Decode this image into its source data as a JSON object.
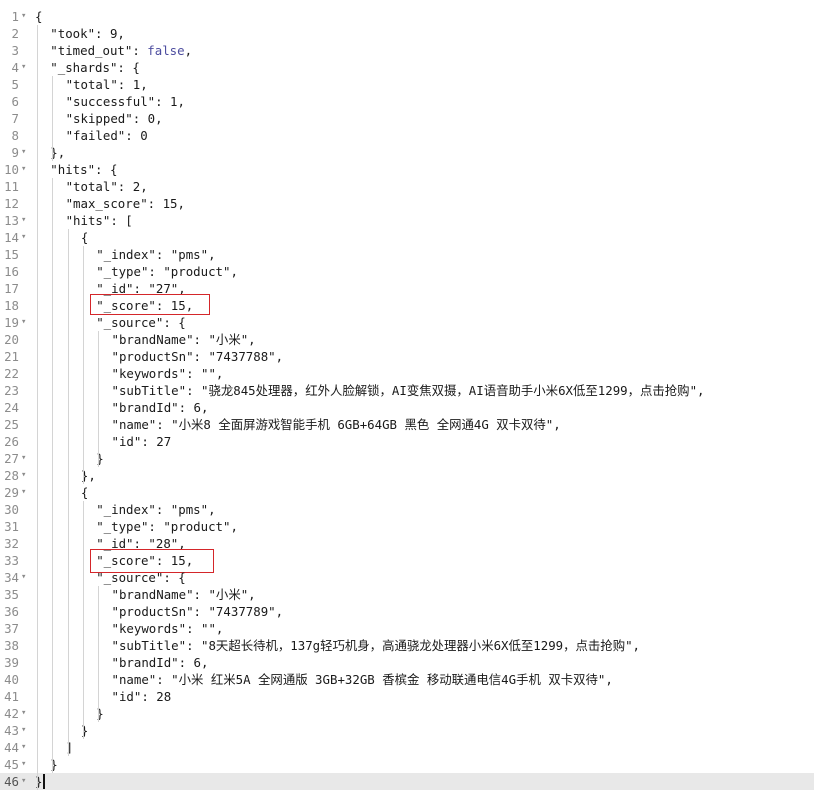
{
  "lines": [
    {
      "n": "1",
      "fold": true,
      "indent": 0,
      "text": "{"
    },
    {
      "n": "2",
      "fold": false,
      "indent": 1,
      "text": "\"took\": 9,"
    },
    {
      "n": "3",
      "fold": false,
      "indent": 1,
      "text": "\"timed_out\": false,"
    },
    {
      "n": "4",
      "fold": true,
      "indent": 1,
      "text": "\"_shards\": {"
    },
    {
      "n": "5",
      "fold": false,
      "indent": 2,
      "text": "\"total\": 1,"
    },
    {
      "n": "6",
      "fold": false,
      "indent": 2,
      "text": "\"successful\": 1,"
    },
    {
      "n": "7",
      "fold": false,
      "indent": 2,
      "text": "\"skipped\": 0,"
    },
    {
      "n": "8",
      "fold": false,
      "indent": 2,
      "text": "\"failed\": 0"
    },
    {
      "n": "9",
      "fold": true,
      "indent": 1,
      "text": "},"
    },
    {
      "n": "10",
      "fold": true,
      "indent": 1,
      "text": "\"hits\": {"
    },
    {
      "n": "11",
      "fold": false,
      "indent": 2,
      "text": "\"total\": 2,"
    },
    {
      "n": "12",
      "fold": false,
      "indent": 2,
      "text": "\"max_score\": 15,"
    },
    {
      "n": "13",
      "fold": true,
      "indent": 2,
      "text": "\"hits\": ["
    },
    {
      "n": "14",
      "fold": true,
      "indent": 3,
      "text": "{"
    },
    {
      "n": "15",
      "fold": false,
      "indent": 4,
      "text": "\"_index\": \"pms\","
    },
    {
      "n": "16",
      "fold": false,
      "indent": 4,
      "text": "\"_type\": \"product\","
    },
    {
      "n": "17",
      "fold": false,
      "indent": 4,
      "text": "\"_id\": \"27\","
    },
    {
      "n": "18",
      "fold": false,
      "indent": 4,
      "text": "\"_score\": 15,"
    },
    {
      "n": "19",
      "fold": true,
      "indent": 4,
      "text": "\"_source\": {"
    },
    {
      "n": "20",
      "fold": false,
      "indent": 5,
      "text": "\"brandName\": \"小米\","
    },
    {
      "n": "21",
      "fold": false,
      "indent": 5,
      "text": "\"productSn\": \"7437788\","
    },
    {
      "n": "22",
      "fold": false,
      "indent": 5,
      "text": "\"keywords\": \"\","
    },
    {
      "n": "23",
      "fold": false,
      "indent": 5,
      "text": "\"subTitle\": \"骁龙845处理器，红外人脸解锁，AI变焦双摄，AI语音助手小米6X低至1299，点击抢购\","
    },
    {
      "n": "24",
      "fold": false,
      "indent": 5,
      "text": "\"brandId\": 6,"
    },
    {
      "n": "25",
      "fold": false,
      "indent": 5,
      "text": "\"name\": \"小米8 全面屏游戏智能手机 6GB+64GB 黑色 全网通4G 双卡双待\","
    },
    {
      "n": "26",
      "fold": false,
      "indent": 5,
      "text": "\"id\": 27"
    },
    {
      "n": "27",
      "fold": true,
      "indent": 4,
      "text": "}"
    },
    {
      "n": "28",
      "fold": true,
      "indent": 3,
      "text": "},"
    },
    {
      "n": "29",
      "fold": true,
      "indent": 3,
      "text": "{"
    },
    {
      "n": "30",
      "fold": false,
      "indent": 4,
      "text": "\"_index\": \"pms\","
    },
    {
      "n": "31",
      "fold": false,
      "indent": 4,
      "text": "\"_type\": \"product\","
    },
    {
      "n": "32",
      "fold": false,
      "indent": 4,
      "text": "\"_id\": \"28\","
    },
    {
      "n": "33",
      "fold": false,
      "indent": 4,
      "text": "\"_score\": 15,"
    },
    {
      "n": "34",
      "fold": true,
      "indent": 4,
      "text": "\"_source\": {"
    },
    {
      "n": "35",
      "fold": false,
      "indent": 5,
      "text": "\"brandName\": \"小米\","
    },
    {
      "n": "36",
      "fold": false,
      "indent": 5,
      "text": "\"productSn\": \"7437789\","
    },
    {
      "n": "37",
      "fold": false,
      "indent": 5,
      "text": "\"keywords\": \"\","
    },
    {
      "n": "38",
      "fold": false,
      "indent": 5,
      "text": "\"subTitle\": \"8天超长待机，137g轻巧机身，高通骁龙处理器小米6X低至1299，点击抢购\","
    },
    {
      "n": "39",
      "fold": false,
      "indent": 5,
      "text": "\"brandId\": 6,"
    },
    {
      "n": "40",
      "fold": false,
      "indent": 5,
      "text": "\"name\": \"小米 红米5A 全网通版 3GB+32GB 香槟金 移动联通电信4G手机 双卡双待\","
    },
    {
      "n": "41",
      "fold": false,
      "indent": 5,
      "text": "\"id\": 28"
    },
    {
      "n": "42",
      "fold": true,
      "indent": 4,
      "text": "}"
    },
    {
      "n": "43",
      "fold": true,
      "indent": 3,
      "text": "}"
    },
    {
      "n": "44",
      "fold": true,
      "indent": 2,
      "text": "]"
    },
    {
      "n": "45",
      "fold": true,
      "indent": 1,
      "text": "}"
    },
    {
      "n": "46",
      "fold": true,
      "indent": 0,
      "text": "}"
    }
  ],
  "active_line": "46",
  "highlighted_lines": [
    "18",
    "33"
  ],
  "colors": {
    "highlight_box": "#d4262a",
    "active_line_bg": "#e8e8e8",
    "line_number": "#8c8c8c",
    "boolean": "#4d4d9f"
  },
  "icons": {
    "fold_marker": "chevron-down-icon"
  }
}
